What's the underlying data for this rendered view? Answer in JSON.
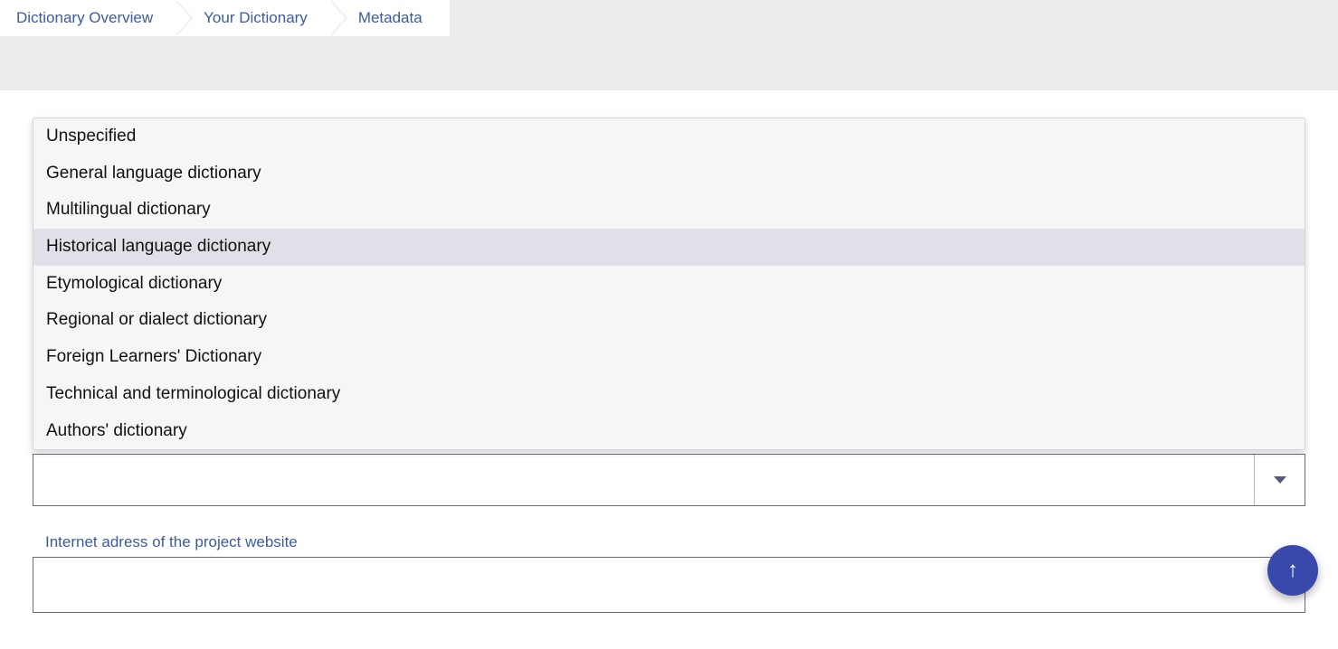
{
  "breadcrumb": {
    "items": [
      {
        "label": "Dictionary Overview"
      },
      {
        "label": "Your Dictionary"
      },
      {
        "label": "Metadata"
      }
    ]
  },
  "dropdown": {
    "options": [
      {
        "label": "Unspecified"
      },
      {
        "label": "General language dictionary"
      },
      {
        "label": "Multilingual dictionary"
      },
      {
        "label": "Historical language dictionary",
        "hovered": true
      },
      {
        "label": "Etymological dictionary"
      },
      {
        "label": "Regional or dialect dictionary"
      },
      {
        "label": "Foreign Learners' Dictionary"
      },
      {
        "label": "Technical and terminological dictionary"
      },
      {
        "label": "Authors' dictionary"
      }
    ],
    "selected_value": ""
  },
  "fields": {
    "website_label": "Internet adress of the project website",
    "website_value": ""
  },
  "fab": {
    "glyph": "↑"
  }
}
